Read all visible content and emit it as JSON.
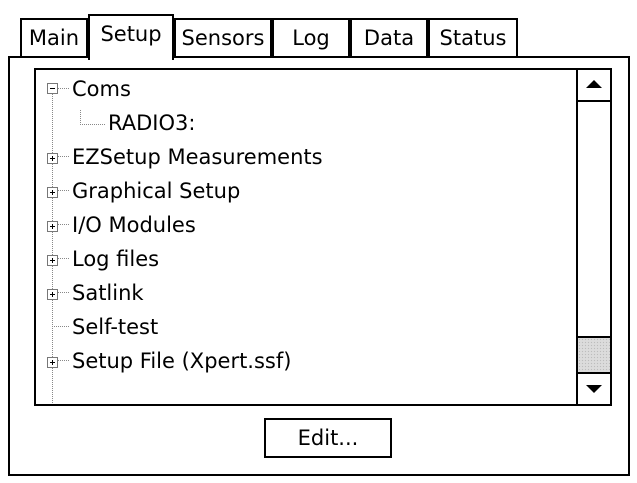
{
  "tabs": [
    {
      "label": "Main"
    },
    {
      "label": "Setup"
    },
    {
      "label": "Sensors"
    },
    {
      "label": "Log"
    },
    {
      "label": "Data"
    },
    {
      "label": "Status"
    }
  ],
  "active_tab": "Setup",
  "tree": {
    "items": [
      {
        "label": "Coms",
        "expander": "minus"
      },
      {
        "label": "RADIO3:",
        "expander": "none"
      },
      {
        "label": "EZSetup Measurements",
        "expander": "plus"
      },
      {
        "label": "Graphical Setup",
        "expander": "plus"
      },
      {
        "label": "I/O Modules",
        "expander": "plus"
      },
      {
        "label": "Log files",
        "expander": "plus"
      },
      {
        "label": "Satlink",
        "expander": "plus"
      },
      {
        "label": "Self-test",
        "expander": "none"
      },
      {
        "label": "Setup File (Xpert.ssf)",
        "expander": "plus"
      }
    ]
  },
  "scrollbar": {
    "up_icon": "arrow-up-icon",
    "down_icon": "arrow-down-icon"
  },
  "buttons": {
    "edit_label": "Edit..."
  }
}
